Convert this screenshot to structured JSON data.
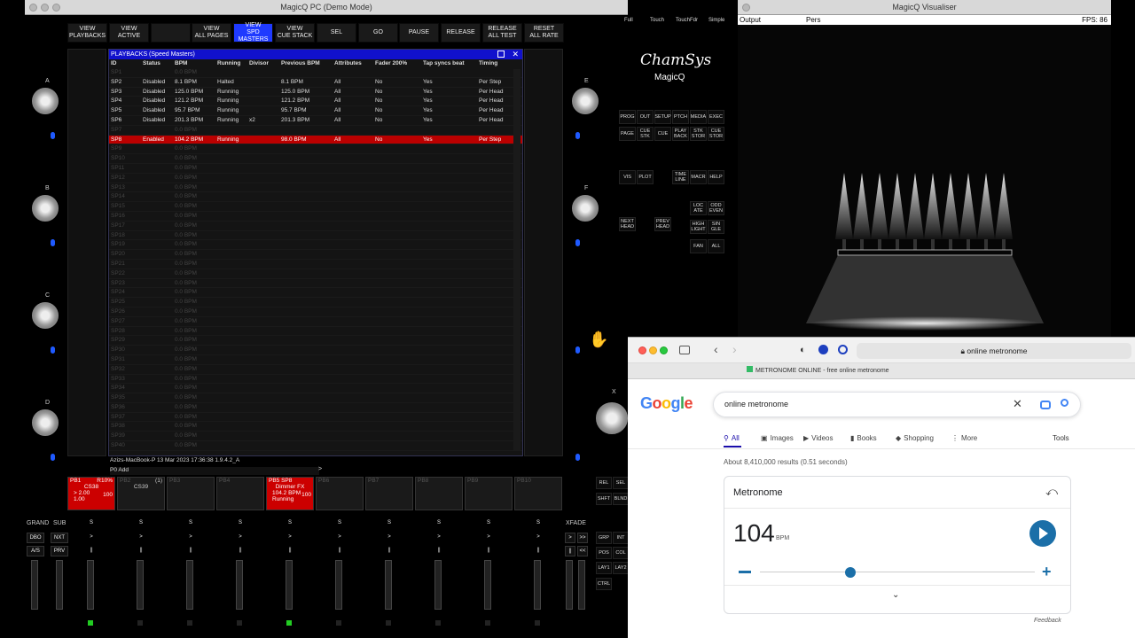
{
  "magicq": {
    "title": "MagicQ PC (Demo Mode)",
    "top_buttons": [
      {
        "label": "VIEW\nPLAYBACKS"
      },
      {
        "label": "VIEW\nACTIVE"
      },
      {
        "label": ""
      },
      {
        "label": "VIEW\nALL PAGES"
      },
      {
        "label": "VIEW\nSPD MASTERS"
      },
      {
        "label": "VIEW\nCUE STACK"
      },
      {
        "label": "SEL"
      },
      {
        "label": "GO"
      },
      {
        "label": "PAUSE"
      },
      {
        "label": "RELEASE"
      },
      {
        "label": "RELEASE\nALL TEST"
      },
      {
        "label": "RESET\nALL RATE"
      }
    ],
    "corner_buttons": [
      "Full",
      "Touch",
      "TouchFdr",
      "Simple"
    ],
    "wheels": [
      "A",
      "B",
      "C",
      "D",
      "E",
      "F",
      "X"
    ],
    "window_title": "PLAYBACKS (Speed Masters)",
    "columns": [
      "ID",
      "Status",
      "BPM",
      "Running",
      "Divisor",
      "Previous BPM",
      "Attributes",
      "Fader 200%",
      "Tap syncs beat",
      "Timing"
    ],
    "rows": [
      [
        "SP1",
        "",
        "0.0 BPM",
        "",
        "",
        "",
        "",
        "",
        "",
        ""
      ],
      [
        "SP2",
        "Disabled",
        "8.1 BPM",
        "Halted",
        "",
        "8.1 BPM",
        "All",
        "No",
        "Yes",
        "Per Step"
      ],
      [
        "SP3",
        "Disabled",
        "125.0 BPM",
        "Running",
        "",
        "125.0 BPM",
        "All",
        "No",
        "Yes",
        "Per Head"
      ],
      [
        "SP4",
        "Disabled",
        "121.2 BPM",
        "Running",
        "",
        "121.2 BPM",
        "All",
        "No",
        "Yes",
        "Per Head"
      ],
      [
        "SP5",
        "Disabled",
        "95.7 BPM",
        "Running",
        "",
        "95.7 BPM",
        "All",
        "No",
        "Yes",
        "Per Head"
      ],
      [
        "SP6",
        "Disabled",
        "201.3 BPM",
        "Running",
        "x2",
        "201.3 BPM",
        "All",
        "No",
        "Yes",
        "Per Head"
      ],
      [
        "SP7",
        "",
        "0.0 BPM",
        "",
        "",
        "",
        "",
        "",
        "",
        ""
      ],
      [
        "SP8",
        "Enabled",
        "104.2 BPM",
        "Running",
        "",
        "98.0 BPM",
        "All",
        "No",
        "Yes",
        "Per Step"
      ],
      [
        "SP9",
        "",
        "0.0 BPM",
        "",
        "",
        "",
        "",
        "",
        "",
        ""
      ],
      [
        "SP10",
        "",
        "0.0 BPM",
        "",
        "",
        "",
        "",
        "",
        "",
        ""
      ],
      [
        "SP11",
        "",
        "0.0 BPM",
        "",
        "",
        "",
        "",
        "",
        "",
        ""
      ],
      [
        "SP12",
        "",
        "0.0 BPM",
        "",
        "",
        "",
        "",
        "",
        "",
        ""
      ],
      [
        "SP13",
        "",
        "0.0 BPM",
        "",
        "",
        "",
        "",
        "",
        "",
        ""
      ],
      [
        "SP14",
        "",
        "0.0 BPM",
        "",
        "",
        "",
        "",
        "",
        "",
        ""
      ],
      [
        "SP15",
        "",
        "0.0 BPM",
        "",
        "",
        "",
        "",
        "",
        "",
        ""
      ],
      [
        "SP16",
        "",
        "0.0 BPM",
        "",
        "",
        "",
        "",
        "",
        "",
        ""
      ],
      [
        "SP17",
        "",
        "0.0 BPM",
        "",
        "",
        "",
        "",
        "",
        "",
        ""
      ],
      [
        "SP18",
        "",
        "0.0 BPM",
        "",
        "",
        "",
        "",
        "",
        "",
        ""
      ],
      [
        "SP19",
        "",
        "0.0 BPM",
        "",
        "",
        "",
        "",
        "",
        "",
        ""
      ],
      [
        "SP20",
        "",
        "0.0 BPM",
        "",
        "",
        "",
        "",
        "",
        "",
        ""
      ],
      [
        "SP21",
        "",
        "0.0 BPM",
        "",
        "",
        "",
        "",
        "",
        "",
        ""
      ],
      [
        "SP22",
        "",
        "0.0 BPM",
        "",
        "",
        "",
        "",
        "",
        "",
        ""
      ],
      [
        "SP23",
        "",
        "0.0 BPM",
        "",
        "",
        "",
        "",
        "",
        "",
        ""
      ],
      [
        "SP24",
        "",
        "0.0 BPM",
        "",
        "",
        "",
        "",
        "",
        "",
        ""
      ],
      [
        "SP25",
        "",
        "0.0 BPM",
        "",
        "",
        "",
        "",
        "",
        "",
        ""
      ],
      [
        "SP26",
        "",
        "0.0 BPM",
        "",
        "",
        "",
        "",
        "",
        "",
        ""
      ],
      [
        "SP27",
        "",
        "0.0 BPM",
        "",
        "",
        "",
        "",
        "",
        "",
        ""
      ],
      [
        "SP28",
        "",
        "0.0 BPM",
        "",
        "",
        "",
        "",
        "",
        "",
        ""
      ],
      [
        "SP29",
        "",
        "0.0 BPM",
        "",
        "",
        "",
        "",
        "",
        "",
        ""
      ],
      [
        "SP30",
        "",
        "0.0 BPM",
        "",
        "",
        "",
        "",
        "",
        "",
        ""
      ],
      [
        "SP31",
        "",
        "0.0 BPM",
        "",
        "",
        "",
        "",
        "",
        "",
        ""
      ],
      [
        "SP32",
        "",
        "0.0 BPM",
        "",
        "",
        "",
        "",
        "",
        "",
        ""
      ],
      [
        "SP33",
        "",
        "0.0 BPM",
        "",
        "",
        "",
        "",
        "",
        "",
        ""
      ],
      [
        "SP34",
        "",
        "0.0 BPM",
        "",
        "",
        "",
        "",
        "",
        "",
        ""
      ],
      [
        "SP35",
        "",
        "0.0 BPM",
        "",
        "",
        "",
        "",
        "",
        "",
        ""
      ],
      [
        "SP36",
        "",
        "0.0 BPM",
        "",
        "",
        "",
        "",
        "",
        "",
        ""
      ],
      [
        "SP37",
        "",
        "0.0 BPM",
        "",
        "",
        "",
        "",
        "",
        "",
        ""
      ],
      [
        "SP38",
        "",
        "0.0 BPM",
        "",
        "",
        "",
        "",
        "",
        "",
        ""
      ],
      [
        "SP39",
        "",
        "0.0 BPM",
        "",
        "",
        "",
        "",
        "",
        "",
        ""
      ],
      [
        "SP40",
        "",
        "0.0 BPM",
        "",
        "",
        "",
        "",
        "",
        "",
        ""
      ]
    ],
    "status_line": "Azizs-MacBook-P 13 Mar 2023 17:36:38 1.9.4.2_A",
    "cmd_line": "P0  Add",
    "playbacks": [
      {
        "id": "PB1",
        "extra": "R10%",
        "name": "CS38",
        "lines": [
          "> 2.00",
          "  1.00"
        ],
        "level": "100",
        "red": true
      },
      {
        "id": "PB2",
        "extra": "(1)",
        "name": "CS39",
        "lines": [],
        "level": "",
        "red": false
      },
      {
        "id": "PB3",
        "extra": "",
        "name": "",
        "lines": [],
        "level": "",
        "red": false
      },
      {
        "id": "PB4",
        "extra": "",
        "name": "",
        "lines": [],
        "level": "",
        "red": false
      },
      {
        "id": "PB5 SP8",
        "extra": "",
        "name": "Dimmer FX",
        "lines": [
          "104.2 BPM",
          "Running"
        ],
        "level": "100",
        "red": true
      },
      {
        "id": "PB6",
        "extra": "",
        "name": "",
        "lines": [],
        "level": "",
        "red": false
      },
      {
        "id": "PB7",
        "extra": "",
        "name": "",
        "lines": [],
        "level": "",
        "red": false
      },
      {
        "id": "PB8",
        "extra": "",
        "name": "",
        "lines": [],
        "level": "",
        "red": false
      },
      {
        "id": "PB9",
        "extra": "",
        "name": "",
        "lines": [],
        "level": "",
        "red": false
      },
      {
        "id": "PB10",
        "extra": "",
        "name": "",
        "lines": [],
        "level": "",
        "red": false
      }
    ],
    "right_buttons": [
      "PROG",
      "OUT",
      "SETUP",
      "PTCH",
      "MEDIA",
      "EXEC",
      "PAGE",
      "CUE\nSTK",
      "CUE",
      "PLAY\nBACK",
      "STK\nSTOR",
      "CUE\nSTOR",
      "VIS",
      "PLOT",
      "TIME\nLINE",
      "MACR",
      "HELP",
      "NEXT\nHEAD",
      "PREV\nHEAD",
      "LOC\nATE",
      "ODD\nEVEN",
      "HIGH\nLIGHT",
      "SIN\nGLE",
      "FAN",
      "ALL"
    ],
    "logo_top": "ChamSys",
    "logo_bottom": "MagicQ",
    "bottom_labels": [
      "GRAND",
      "SUB",
      "XFADE"
    ],
    "bottom_buttons": [
      "DBO",
      "NXT",
      "A/S",
      "PRV"
    ],
    "corner_small": [
      "REL",
      "SEL",
      "SHFT",
      "BLND"
    ],
    "xfade_buttons": [
      "GRP",
      "INT",
      "POS",
      "COL",
      "LAY1",
      "LAY2",
      "CTRL"
    ]
  },
  "visualiser": {
    "title": "MagicQ Visualiser",
    "menu": [
      "Output",
      "Pers"
    ],
    "fps": "FPS: 86"
  },
  "browser": {
    "address": "online metronome",
    "tab_title": "METRONOME ONLINE - free online metronome",
    "logo": "Google",
    "query": "online metronome",
    "tabs": [
      "All",
      "Images",
      "Videos",
      "Books",
      "Shopping",
      "More"
    ],
    "tools": "Tools",
    "results": "About 8,410,000 results (0.51 seconds)",
    "card_title": "Metronome",
    "bpm": "104",
    "bpm_unit": "BPM",
    "slider_fraction": 0.33,
    "feedback": "Feedback"
  }
}
